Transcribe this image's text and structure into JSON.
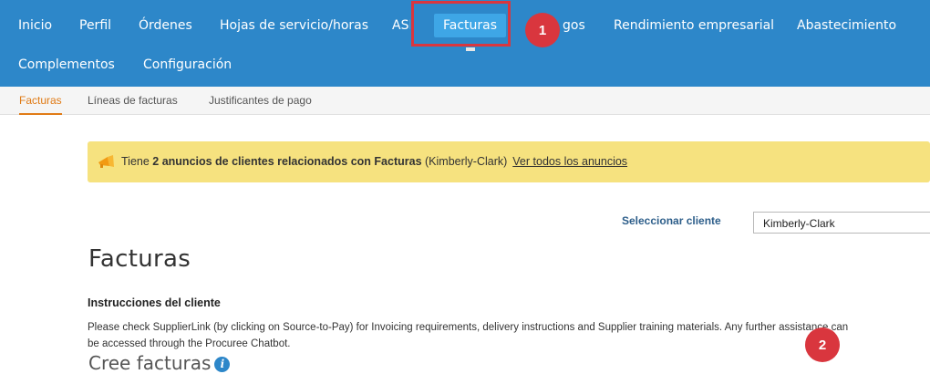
{
  "nav": {
    "items": [
      {
        "label": "Inicio"
      },
      {
        "label": "Perfil"
      },
      {
        "label": "Órdenes"
      },
      {
        "label": "Hojas de servicio/horas"
      },
      {
        "label": "ASN"
      },
      {
        "label": "Facturas"
      },
      {
        "label": "gos"
      },
      {
        "label": "Rendimiento empresarial"
      },
      {
        "label": "Abastecimiento"
      },
      {
        "label": "Complementos"
      },
      {
        "label": "Configuración"
      }
    ],
    "active": "Facturas"
  },
  "annotations": {
    "marker1": "1",
    "marker2": "2",
    "highlight_color": "#d9363e"
  },
  "subnav": {
    "items": [
      {
        "label": "Facturas"
      },
      {
        "label": "Líneas de facturas"
      },
      {
        "label": "Justificantes de pago"
      }
    ]
  },
  "banner": {
    "icon": "megaphone-icon",
    "text_before": "Tiene ",
    "text_bold": "2 anuncios de clientes relacionados con Facturas",
    "text_after": " (Kimberly-Clark)",
    "link": "Ver todos los anuncios",
    "color": "#f6e27f"
  },
  "customer": {
    "label": "Seleccionar cliente",
    "selected": "Kimberly-Clark"
  },
  "page": {
    "title": "Facturas",
    "instructions_heading": "Instrucciones del cliente",
    "instructions_line1": "Please check SupplierLink (by clicking on Source-to-Pay) for Invoicing requirements, delivery instructions and Supplier training materials. Any further assistance can",
    "instructions_line2": "be accessed through the Procuree Chatbot.",
    "create_heading": "Cree facturas",
    "info_icon": "info-icon"
  },
  "colors": {
    "nav_bg": "#2d87c9",
    "nav_active": "#3ea6e6",
    "subnav_active": "#e07b16"
  }
}
